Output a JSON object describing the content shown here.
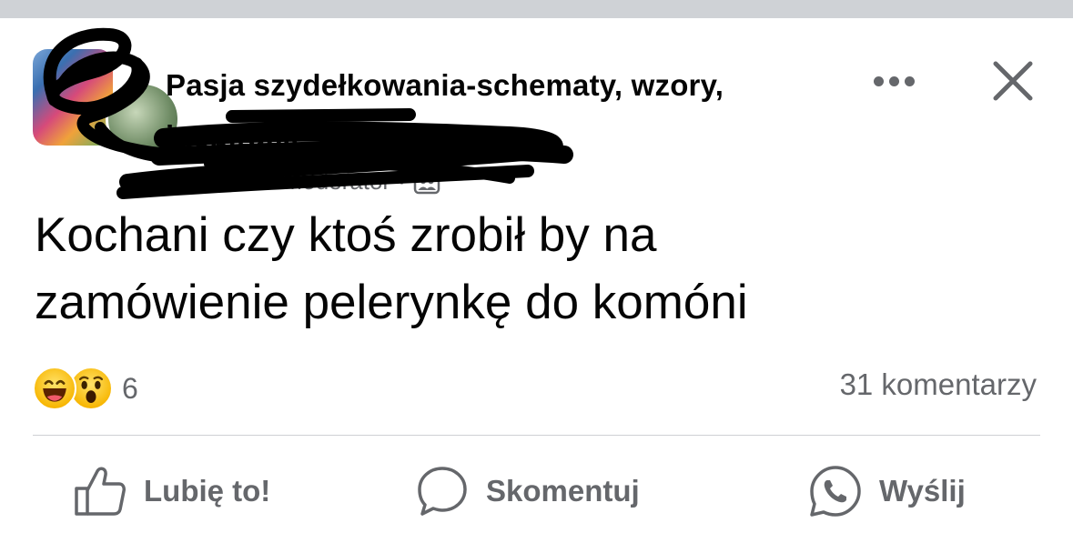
{
  "post": {
    "group_name": "Pasja szydełkowania-schematy, wzory, inspiracje",
    "author_obscured": "Ewa Dr... · Moderator",
    "separator": "·",
    "text_line1": "Kochani czy ktoś zrobił by na",
    "text_line2": "zamówienie pelerynkę do komóni",
    "reaction_count": "6",
    "comment_count": "31 komentarzy"
  },
  "actions": {
    "like_label": "Lubię to!",
    "comment_label": "Skomentuj",
    "share_label": "Wyślij"
  },
  "colors": {
    "muted_text": "#65676b",
    "divider": "#ced0d4",
    "reaction_yellow": "#f7b500"
  },
  "icons": [
    "more-icon",
    "close-icon",
    "group-members-icon",
    "haha-reaction-icon",
    "wow-reaction-icon",
    "like-icon",
    "comment-icon",
    "whatsapp-icon"
  ]
}
